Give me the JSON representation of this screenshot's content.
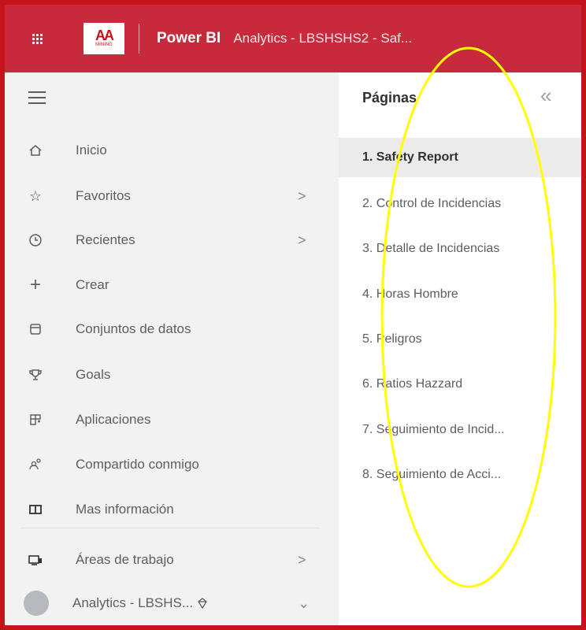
{
  "header": {
    "logo_text": "AA",
    "logo_sub": "MINING",
    "app_name": "Power BI",
    "report_title": "Analytics - LBSHSHS2 - Saf..."
  },
  "nav": {
    "items": [
      {
        "label": "Inicio",
        "icon": "home-icon"
      },
      {
        "label": "Favoritos",
        "icon": "star-icon",
        "chevron": ">"
      },
      {
        "label": "Recientes",
        "icon": "clock-icon",
        "chevron": ">"
      },
      {
        "label": "Crear",
        "icon": "plus-icon"
      },
      {
        "label": "Conjuntos de datos",
        "icon": "dataset-icon"
      },
      {
        "label": "Goals",
        "icon": "trophy-icon"
      },
      {
        "label": "Aplicaciones",
        "icon": "apps-icon"
      },
      {
        "label": "Compartido conmigo",
        "icon": "shared-icon"
      },
      {
        "label": "Mas información",
        "icon": "book-icon"
      },
      {
        "label": "Áreas de trabajo",
        "icon": "workspaces-icon",
        "chevron": ">"
      },
      {
        "label": "Analytics - LBSHS...",
        "icon": "workspace-avatar",
        "chevron": "⌄"
      }
    ]
  },
  "pages": {
    "title": "Páginas",
    "collapse_glyph": "«",
    "items": [
      "1. Safety Report",
      "2. Control de Incidencias",
      "3. Detalle de Incidencias",
      "4. Horas Hombre",
      "5. Peligros",
      "6. Ratios Hazzard",
      "7. Seguimiento de Incid...",
      "8. Seguimiento de Acci..."
    ],
    "active_index": 0
  },
  "colors": {
    "header_bg": "#c72a3a",
    "frame_border": "#c4131b",
    "annotation": "#ffff00"
  }
}
